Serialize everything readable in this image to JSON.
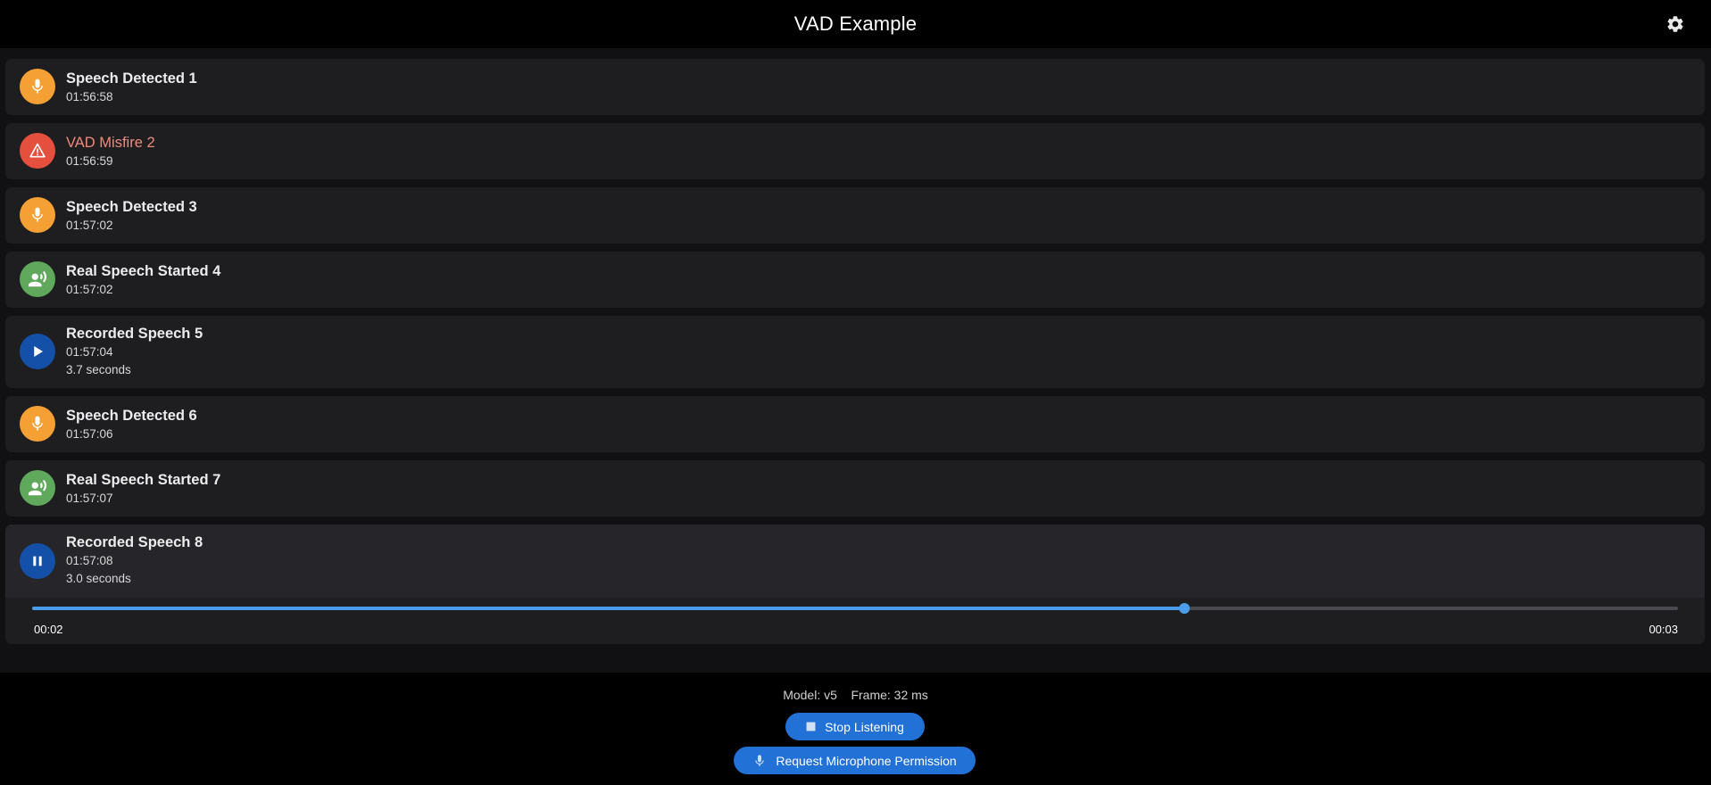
{
  "appbar": {
    "title": "VAD Example",
    "settings_icon": "gear-icon"
  },
  "events": [
    {
      "title": "Speech Detected 1",
      "time": "01:56:58",
      "icon": "microphone-icon",
      "color": "#f5a035"
    },
    {
      "title": "VAD Misfire 2",
      "time": "01:56:59",
      "icon": "warning-triangle-icon",
      "color": "#e5503e"
    },
    {
      "title": "Speech Detected 3",
      "time": "01:57:02",
      "icon": "microphone-icon",
      "color": "#f5a035"
    },
    {
      "title": "Real Speech Started 4",
      "time": "01:57:02",
      "icon": "record-voice-icon",
      "color": "#5fa85c"
    },
    {
      "title": "Recorded Speech 5",
      "time": "01:57:04",
      "duration": "3.7 seconds",
      "icon": "play-icon",
      "color": "#1550a8"
    },
    {
      "title": "Speech Detected 6",
      "time": "01:57:06",
      "icon": "microphone-icon",
      "color": "#f5a035"
    },
    {
      "title": "Real Speech Started 7",
      "time": "01:57:07",
      "icon": "record-voice-icon",
      "color": "#5fa85c"
    },
    {
      "title": "Recorded Speech 8",
      "time": "01:57:08",
      "duration": "3.0 seconds",
      "icon": "pause-icon",
      "color": "#1550a8"
    }
  ],
  "player": {
    "position": "00:02",
    "duration": "00:03",
    "progress": 0.7
  },
  "footer": {
    "model_label": "Model: v5",
    "frame_label": "Frame: 32 ms",
    "stop_button": "Stop Listening",
    "permission_button": "Request Microphone Permission"
  },
  "colors": {
    "accent": "#2171d6",
    "slider": "#4a9de8",
    "misfire_text": "#ef8a7e"
  }
}
